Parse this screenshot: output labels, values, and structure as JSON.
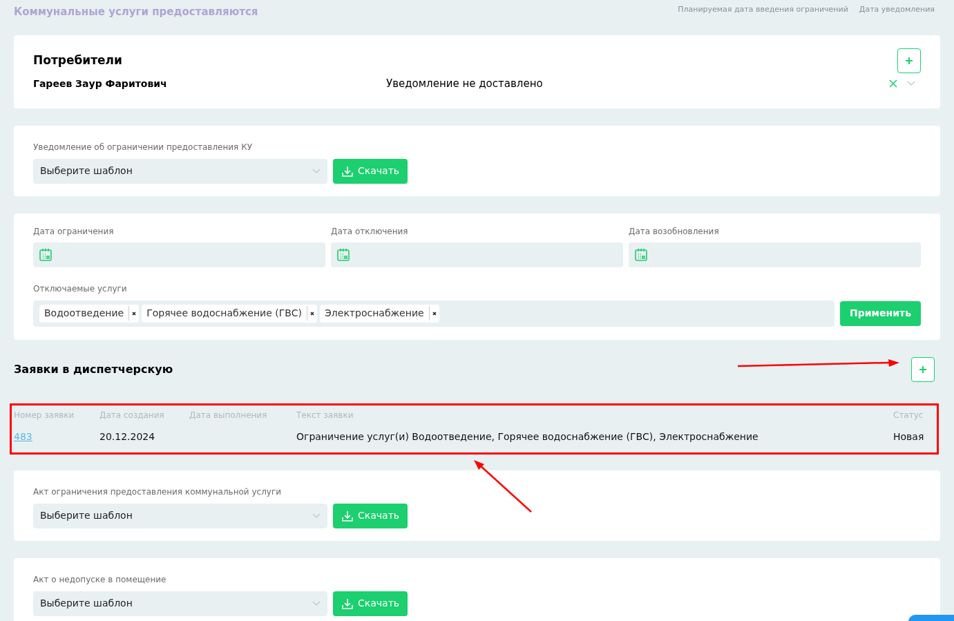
{
  "header": {
    "title": "Коммунальные услуги предоставляются",
    "columns": [
      "Планируемая дата введения ограничений",
      "Дата уведомления"
    ]
  },
  "consumers": {
    "title": "Потребители",
    "items": [
      {
        "name": "Гареев Заур Фаритович",
        "status": "Уведомление не доставлено",
        "expanded": false
      }
    ]
  },
  "notice": {
    "label": "Уведомление об ограничении предоставления КУ",
    "placeholder": "Выберите шаблон",
    "button": "Скачать"
  },
  "restriction": {
    "dates": [
      {
        "label": "Дата ограничения"
      },
      {
        "label": "Дата отключения"
      },
      {
        "label": "Дата возобновления"
      }
    ],
    "services_label": "Отключаемые услуги",
    "services": [
      "Водоотведение",
      "Горячее водоснабжение (ГВС)",
      "Электроснабжение"
    ],
    "apply": "Применить"
  },
  "requests": {
    "title": "Заявки в диспетчерскую",
    "columns": [
      "Номер заявки",
      "Дата создания",
      "Дата выполнения",
      "Текст заявки",
      "Статус"
    ],
    "rows": [
      {
        "number": "483",
        "created": "20.12.2024",
        "done": "",
        "text": "Ограничение услуг(и) Водоотведение, Горячее водоснабжение (ГВС), Электроснабжение",
        "status": "Новая"
      }
    ]
  },
  "acts": [
    {
      "label": "Акт ограничения предоставления коммунальной услуги",
      "placeholder": "Выберите шаблон",
      "button": "Скачать"
    },
    {
      "label": "Акт о недопуске в помещение",
      "placeholder": "Выберите шаблон",
      "button": "Скачать"
    }
  ]
}
